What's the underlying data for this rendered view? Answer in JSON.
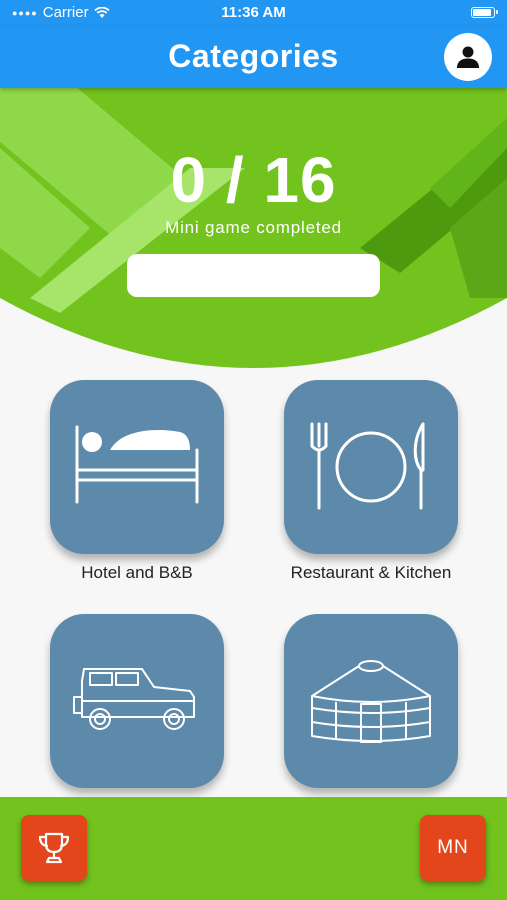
{
  "status_bar": {
    "carrier": "Carrier",
    "time": "11:36 AM"
  },
  "header": {
    "title": "Categories"
  },
  "progress": {
    "completed_text": "0 / 16",
    "caption": "Mini game completed",
    "value": 0
  },
  "categories": [
    {
      "label": "Hotel and B&B",
      "icon": "bed-icon"
    },
    {
      "label": "Restaurant & Kitchen",
      "icon": "plate-cutlery-icon"
    },
    {
      "label": "",
      "icon": "jeep-icon"
    },
    {
      "label": "",
      "icon": "yurt-icon"
    }
  ],
  "footer": {
    "trophy_icon": "trophy-icon",
    "user_initials": "MN"
  },
  "colors": {
    "header_blue": "#2196f3",
    "green": "#72c31e",
    "tile_blue": "#5d8aaa",
    "accent_orange": "#e3461b"
  }
}
